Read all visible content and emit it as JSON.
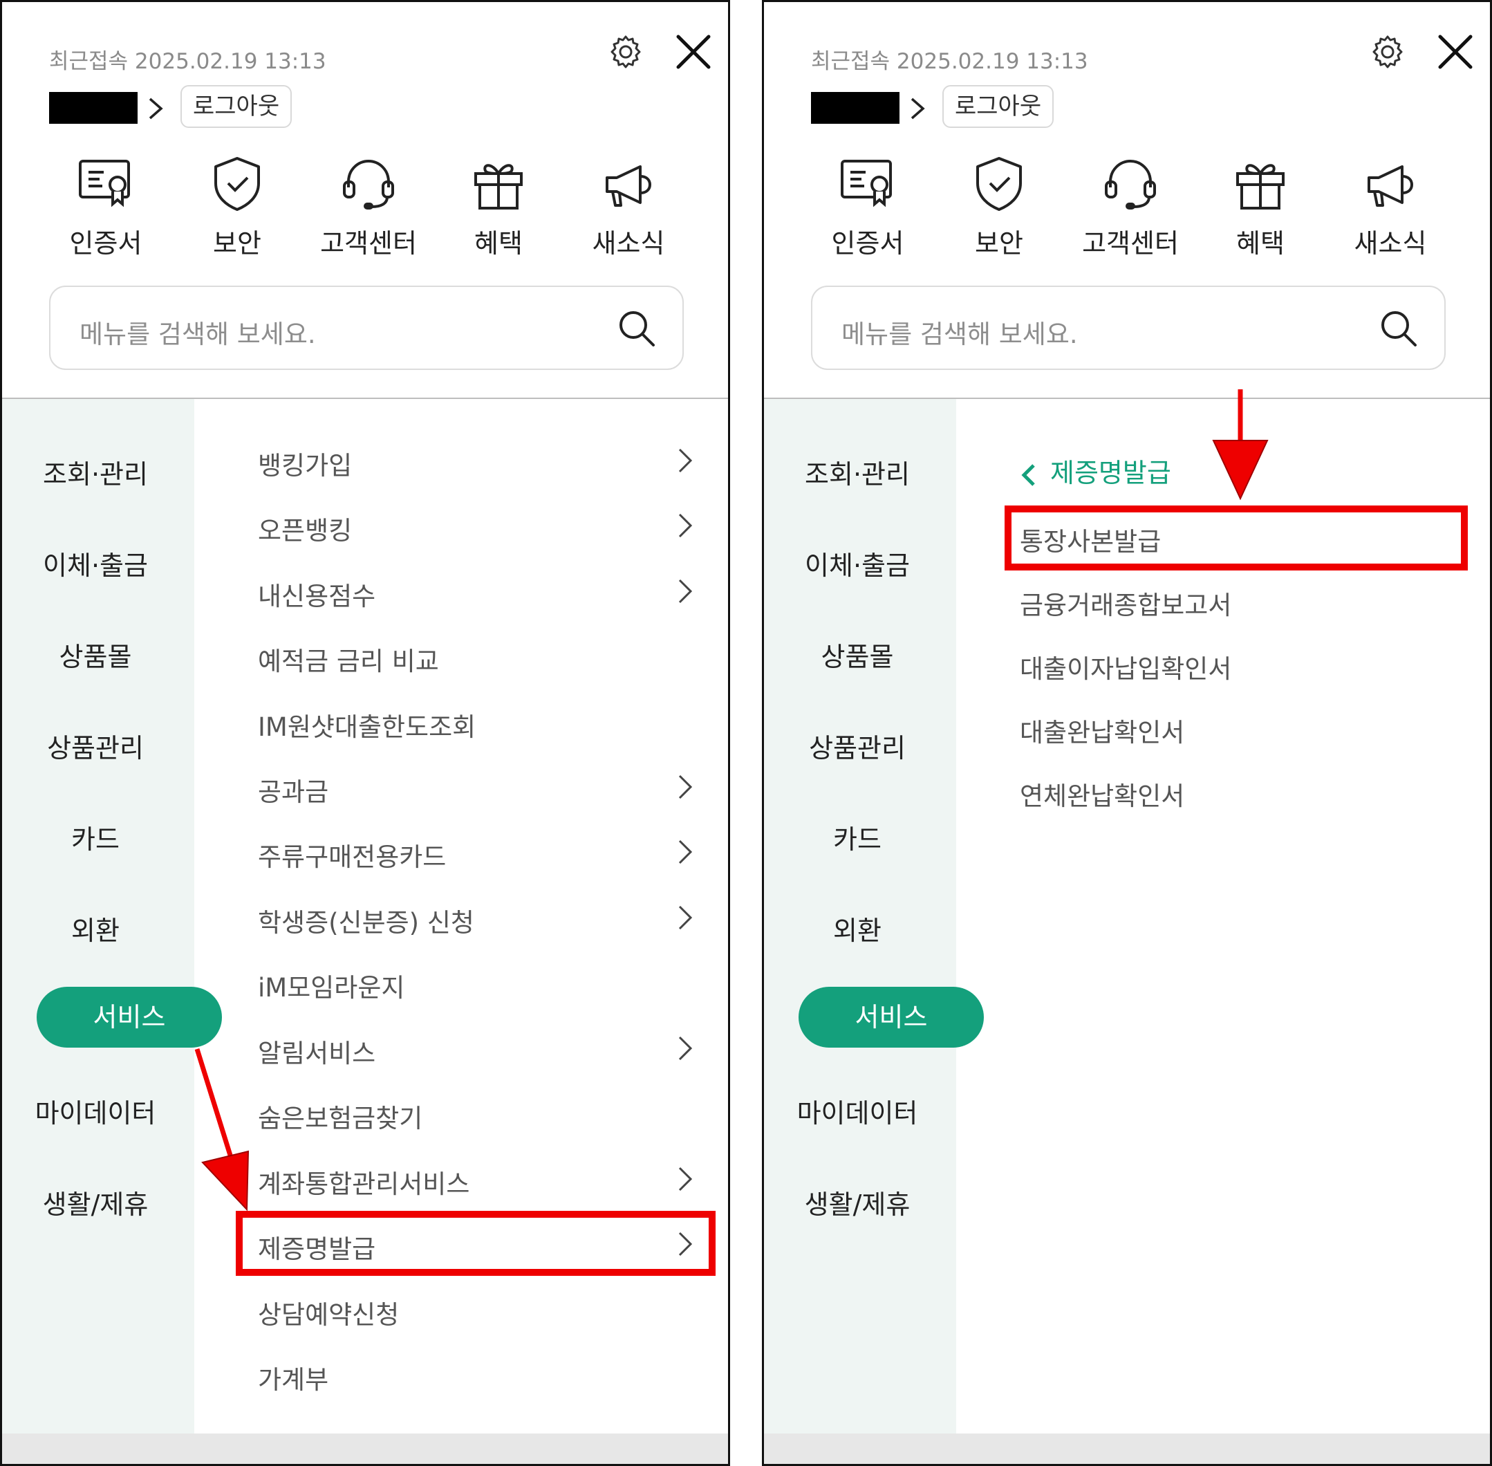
{
  "header": {
    "last_login": "최근접속 2025.02.19 13:13",
    "logout_label": "로그아웃"
  },
  "quick_menu": [
    {
      "label": "인증서",
      "icon": "certificate-icon"
    },
    {
      "label": "보안",
      "icon": "shield-check-icon"
    },
    {
      "label": "고객센터",
      "icon": "headset-icon"
    },
    {
      "label": "혜택",
      "icon": "gift-icon"
    },
    {
      "label": "새소식",
      "icon": "megaphone-icon"
    }
  ],
  "search": {
    "placeholder": "메뉴를 검색해 보세요."
  },
  "categories": [
    "조회·관리",
    "이체·출금",
    "상품몰",
    "상품관리",
    "카드",
    "외환",
    "서비스",
    "마이데이터",
    "생활/제휴"
  ],
  "active_category": "서비스",
  "service_menu": [
    {
      "label": "뱅킹가입",
      "has_arrow": true
    },
    {
      "label": "오픈뱅킹",
      "has_arrow": true
    },
    {
      "label": "내신용점수",
      "has_arrow": true
    },
    {
      "label": "예적금 금리 비교",
      "has_arrow": false
    },
    {
      "label": "IM원샷대출한도조회",
      "has_arrow": false
    },
    {
      "label": "공과금",
      "has_arrow": true
    },
    {
      "label": "주류구매전용카드",
      "has_arrow": true
    },
    {
      "label": "학생증(신분증) 신청",
      "has_arrow": true
    },
    {
      "label": "iM모임라운지",
      "has_arrow": false
    },
    {
      "label": "알림서비스",
      "has_arrow": true
    },
    {
      "label": "숨은보험금찾기",
      "has_arrow": false
    },
    {
      "label": "계좌통합관리서비스",
      "has_arrow": true
    },
    {
      "label": "제증명발급",
      "has_arrow": true
    },
    {
      "label": "상담예약신청",
      "has_arrow": false
    },
    {
      "label": "가계부",
      "has_arrow": false
    }
  ],
  "certificate_menu": {
    "back_label": "제증명발급",
    "items": [
      "통장사본발급",
      "금융거래종합보고서",
      "대출이자납입확인서",
      "대출완납확인서",
      "연체완납확인서"
    ]
  },
  "colors": {
    "accent": "#14a07c",
    "highlight": "#ee0000",
    "sidebar_bg": "#eff5f3"
  }
}
